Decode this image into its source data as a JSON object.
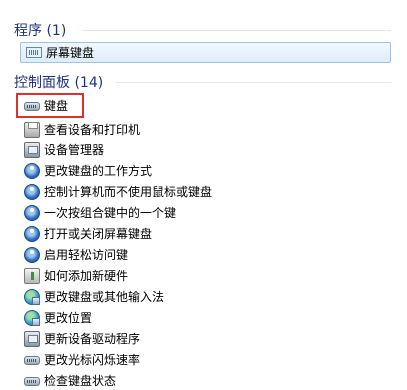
{
  "sections": {
    "programs": {
      "title": "程序 (1)"
    },
    "control_panel": {
      "title": "控制面板 (14)"
    }
  },
  "programs_items": [
    {
      "label": "屏幕键盘",
      "icon": "on-screen-keyboard-icon"
    }
  ],
  "control_panel_items": [
    {
      "label": "键盘",
      "icon": "keyboard-icon"
    },
    {
      "label": "查看设备和打印机",
      "icon": "printer-icon"
    },
    {
      "label": "设备管理器",
      "icon": "device-manager-icon"
    },
    {
      "label": "更改键盘的工作方式",
      "icon": "ease-of-access-icon"
    },
    {
      "label": "控制计算机而不使用鼠标或键盘",
      "icon": "ease-of-access-icon"
    },
    {
      "label": "一次按组合键中的一个键",
      "icon": "ease-of-access-icon"
    },
    {
      "label": "打开或关闭屏幕键盘",
      "icon": "ease-of-access-icon"
    },
    {
      "label": "启用轻松访问键",
      "icon": "ease-of-access-icon"
    },
    {
      "label": "如何添加新硬件",
      "icon": "hardware-wizard-icon"
    },
    {
      "label": "更改键盘或其他输入法",
      "icon": "region-language-icon"
    },
    {
      "label": "更改位置",
      "icon": "region-language-icon"
    },
    {
      "label": "更新设备驱动程序",
      "icon": "device-manager-icon"
    },
    {
      "label": "更改光标闪烁速率",
      "icon": "keyboard-icon"
    },
    {
      "label": "检查键盘状态",
      "icon": "keyboard-icon"
    }
  ],
  "colors": {
    "section_header": "#1e3287",
    "highlight_box": "#e0312a",
    "selection_border": "#99c5ea"
  }
}
